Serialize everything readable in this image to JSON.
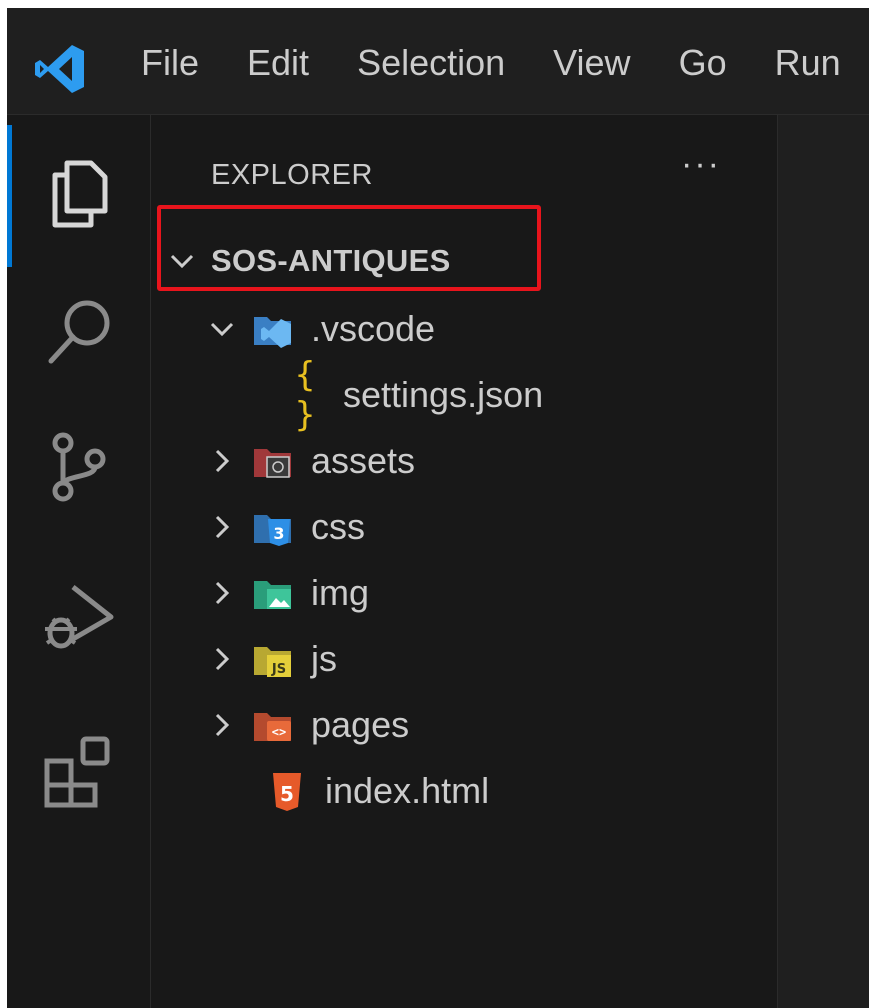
{
  "menu": {
    "items": [
      "File",
      "Edit",
      "Selection",
      "View",
      "Go",
      "Run"
    ]
  },
  "activity_bar": {
    "icons": [
      "explorer-icon",
      "search-icon",
      "source-control-icon",
      "run-debug-icon",
      "extensions-icon"
    ]
  },
  "explorer": {
    "title": "EXPLORER",
    "more": "···",
    "root": "SOS-ANTIQUES",
    "tree": [
      {
        "label": ".vscode",
        "icon": "vscode-folder-icon",
        "expanded": true
      },
      {
        "label": "settings.json",
        "icon": "json-file-icon"
      },
      {
        "label": "assets",
        "icon": "assets-folder-icon",
        "expanded": false
      },
      {
        "label": "css",
        "icon": "css-folder-icon",
        "expanded": false
      },
      {
        "label": "img",
        "icon": "img-folder-icon",
        "expanded": false
      },
      {
        "label": "js",
        "icon": "js-folder-icon",
        "expanded": false
      },
      {
        "label": "pages",
        "icon": "pages-folder-icon",
        "expanded": false
      },
      {
        "label": "index.html",
        "icon": "html-file-icon"
      }
    ]
  },
  "colors": {
    "accent": "#0078d4",
    "highlight_box": "#e8141c",
    "json_braces": "#e8c020"
  }
}
